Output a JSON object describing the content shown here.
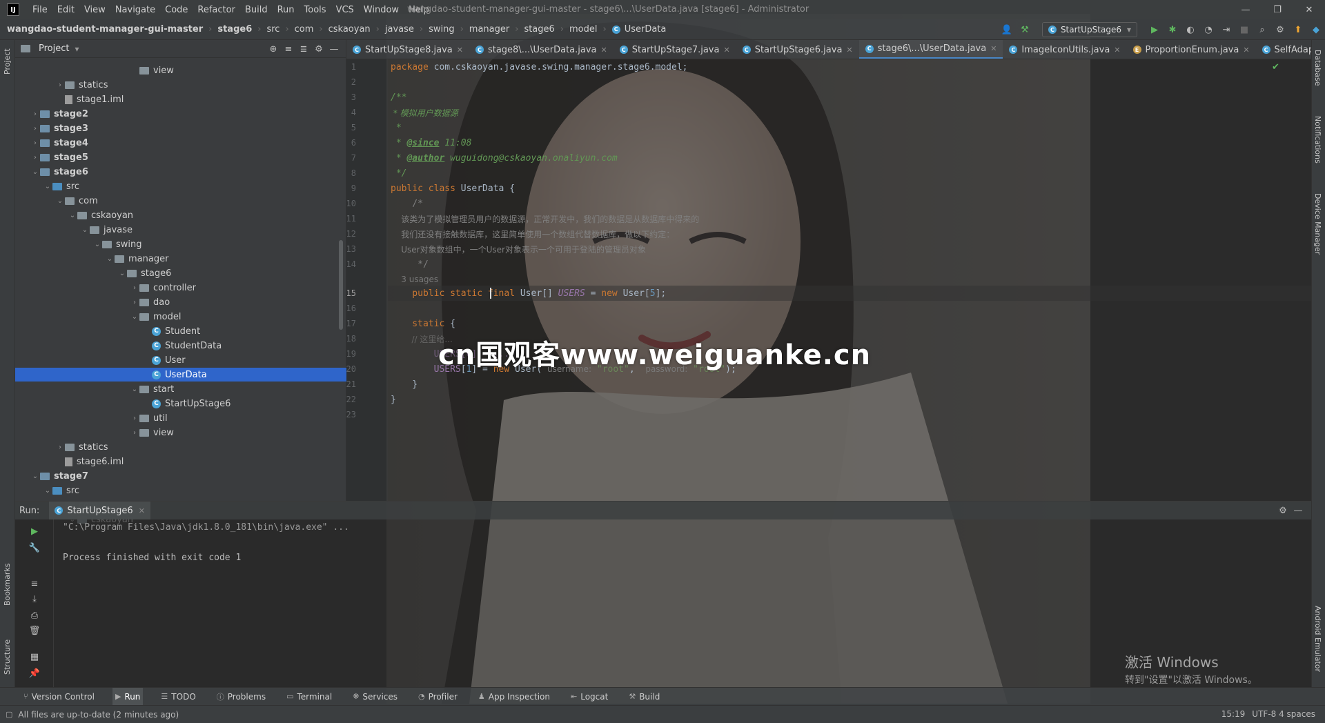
{
  "window": {
    "title": "wangdao-student-manager-gui-master - stage6\\...\\UserData.java [stage6] - Administrator",
    "menu": [
      "File",
      "Edit",
      "View",
      "Navigate",
      "Code",
      "Refactor",
      "Build",
      "Run",
      "Tools",
      "VCS",
      "Window",
      "Help"
    ]
  },
  "breadcrumb": [
    "wangdao-student-manager-gui-master",
    "stage6",
    "src",
    "com",
    "cskaoyan",
    "javase",
    "swing",
    "manager",
    "stage6",
    "model",
    "UserData"
  ],
  "run_config": "StartUpStage6",
  "project": {
    "title": "Project",
    "tree": [
      {
        "label": "view",
        "depth": 9
      },
      {
        "label": "statics",
        "depth": 3
      },
      {
        "label": "stage1.iml",
        "depth": 3
      },
      {
        "label": "stage2",
        "depth": 1
      },
      {
        "label": "stage3",
        "depth": 1
      },
      {
        "label": "stage4",
        "depth": 1
      },
      {
        "label": "stage5",
        "depth": 1
      },
      {
        "label": "stage6",
        "depth": 1
      },
      {
        "label": "src",
        "depth": 2
      },
      {
        "label": "com",
        "depth": 3
      },
      {
        "label": "cskaoyan",
        "depth": 4
      },
      {
        "label": "javase",
        "depth": 5
      },
      {
        "label": "swing",
        "depth": 6
      },
      {
        "label": "manager",
        "depth": 7
      },
      {
        "label": "stage6",
        "depth": 8
      },
      {
        "label": "controller",
        "depth": 9
      },
      {
        "label": "dao",
        "depth": 9
      },
      {
        "label": "model",
        "depth": 9
      },
      {
        "label": "Student",
        "depth": 10
      },
      {
        "label": "StudentData",
        "depth": 10
      },
      {
        "label": "User",
        "depth": 10
      },
      {
        "label": "UserData",
        "depth": 10
      },
      {
        "label": "start",
        "depth": 9
      },
      {
        "label": "StartUpStage6",
        "depth": 10
      },
      {
        "label": "util",
        "depth": 9
      },
      {
        "label": "view",
        "depth": 9
      },
      {
        "label": "statics",
        "depth": 3
      },
      {
        "label": "stage6.iml",
        "depth": 3
      },
      {
        "label": "stage7",
        "depth": 1
      },
      {
        "label": "src",
        "depth": 2
      },
      {
        "label": "com",
        "depth": 3
      },
      {
        "label": "cskaoyan",
        "depth": 4
      }
    ]
  },
  "tabs": [
    "StartUpStage8.java",
    "stage8\\...\\UserData.java",
    "StartUpStage7.java",
    "StartUpStage6.java",
    "stage6\\...\\UserData.java",
    "ImageIconUtils.java",
    "ProportionEnum.java",
    "SelfAdaptiveScreenJ"
  ],
  "editor": {
    "line_numbers": [
      "1",
      "2",
      "3",
      "4",
      "5",
      "6",
      "7",
      "8",
      "9",
      "10",
      "11",
      "12",
      "13",
      "14",
      "",
      "15",
      "16",
      "17",
      "18",
      "19",
      "20",
      "21",
      "22",
      "23"
    ],
    "code": {
      "l1_kw": "package",
      "l1_rest": " com.cskaoyan.javase.swing.manager.stage6.model;",
      "l3": "/**",
      "l4": " * 模拟用户数据源",
      "l5": " *",
      "l6_star": " * ",
      "l6_tag": "@since",
      "l6_val": " 11:08",
      "l7_star": " * ",
      "l7_tag": "@author",
      "l7_val": " wuguidong@cskaoyan.onaliyun.com",
      "l8": " */",
      "l9_kw": "public class",
      "l9_rest": " UserData {",
      "l10": "    /*",
      "l11": "    该类为了模拟管理员用户的数据源，正常开发中，我们的数据是从数据库中得来的",
      "l12": "    我们还没有接触数据库，这里简单使用一个数组代替数据库，做以下约定：",
      "l13": "    User对象数组中，一个User对象表示一个可用于登陆的管理员对象",
      "l14": "     */",
      "usages": "    3 usages",
      "l15_kw": "    public static ",
      "l15_kw2": "final",
      "l15_type": " User[] ",
      "l15_field": "USERS",
      "l15_eq": " = ",
      "l15_new": "new",
      "l15_tail1": " User[",
      "l15_num": "5",
      "l15_tail2": "];",
      "l17_kw": "    static",
      "l17_rest": " {",
      "l18": "        // 这里给...",
      "l19": "        USERS[0] = ...",
      "l20_field": "        USERS",
      "l20_idx1": "[",
      "l20_num": "1",
      "l20_idx2": "] = ",
      "l20_new": "new",
      "l20_call": " User( ",
      "l20_h1": "username:",
      "l20_s1": " \"root\"",
      "l20_comma": ",  ",
      "l20_h2": "password:",
      "l20_s2": " \"root\"",
      "l20_end": ");",
      "l21": "    }",
      "l22": "}"
    }
  },
  "watermark": "cn国观客www.weiguanke.cn",
  "run": {
    "label": "Run:",
    "tab": "StartUpStage6",
    "output": [
      "\"C:\\Program Files\\Java\\jdk1.8.0_181\\bin\\java.exe\" ...",
      "Process finished with exit code 1"
    ]
  },
  "activate": {
    "title": "激活 Windows",
    "subtitle": "转到\"设置\"以激活 Windows。"
  },
  "tool_windows": [
    "Version Control",
    "Run",
    "TODO",
    "Problems",
    "Terminal",
    "Services",
    "Profiler",
    "App Inspection",
    "Logcat",
    "Build"
  ],
  "side_labels": {
    "left": [
      "Project",
      "Bookmarks",
      "Structure"
    ],
    "right": [
      "Database",
      "Notifications",
      "Device Manager",
      "Android Emulator"
    ]
  },
  "status": {
    "message": "All files are up-to-date (2 minutes ago)",
    "position": "15:19",
    "right_tail": "UTF-8  4 spaces"
  },
  "colors": {
    "accent": "#2f65ca",
    "tab_underline": "#4a88c7",
    "keyword": "#cc7832",
    "string": "#6a8759",
    "number": "#6897bb",
    "field": "#9876aa"
  }
}
